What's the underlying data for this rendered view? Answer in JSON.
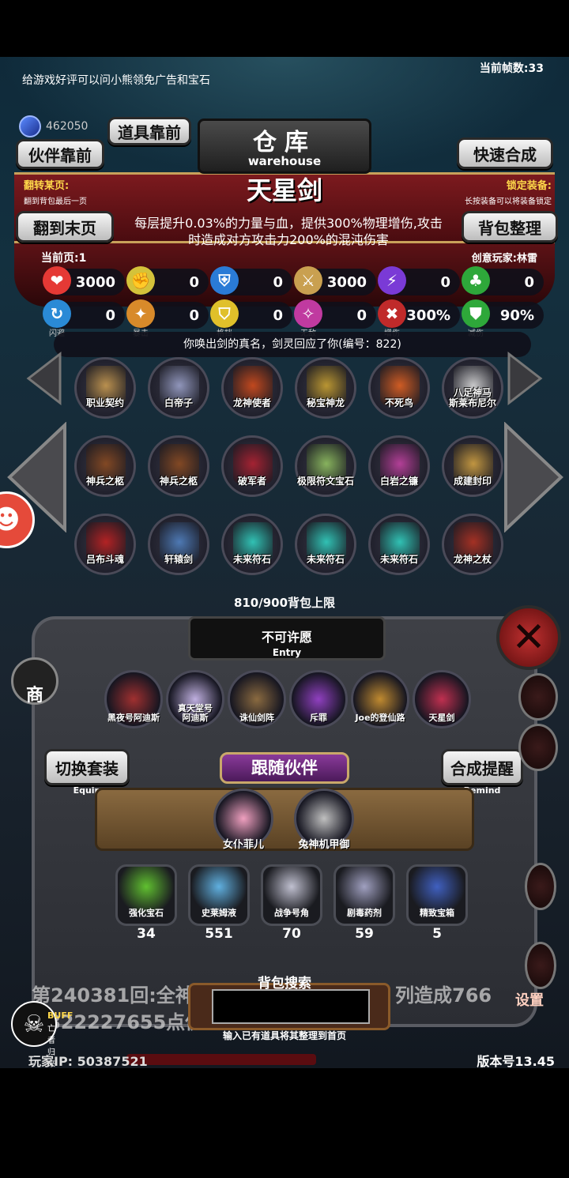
{
  "top_notice": "给游戏好评可以问小熊领免广告和宝石",
  "fps_label": "当前帧数:33",
  "gem_count": "462050",
  "buttons": {
    "props_front": "道具靠前",
    "companion_front": "伙伴靠前",
    "quick_synthesis": "快速合成",
    "jump_last": "翻到末页",
    "bag_sort": "背包整理",
    "switch_set": "切换套装",
    "switch_set_sub": "Equip",
    "synthesis_remind": "合成提醒",
    "synthesis_remind_sub": "Remind"
  },
  "header": {
    "title_cn": "仓库",
    "title_en": "warehouse"
  },
  "flip": {
    "label": "翻转某页:",
    "sub": "翻到背包最后一页"
  },
  "lock": {
    "label": "锁定装备:",
    "sub": "长按装备可以将装备锁定"
  },
  "selected_item": {
    "name": "天星剑",
    "description": "每层提升0.03%的力量与血，提供300%物理增伤,攻击时造成对方攻击力200%的混沌伤害"
  },
  "current_page": "当前页:1",
  "creator": "创意玩家:林雷",
  "stats_row1": [
    {
      "icon": "heart-icon",
      "glyph": "❤",
      "color": "#e53935",
      "value": "3000"
    },
    {
      "icon": "strength-icon",
      "glyph": "✊",
      "color": "#d4c23a",
      "value": "0"
    },
    {
      "icon": "armor-icon",
      "glyph": "⛨",
      "color": "#2a7bd6",
      "value": "0"
    },
    {
      "icon": "sword-icon",
      "glyph": "⚔",
      "color": "#c9a050",
      "value": "3000"
    },
    {
      "icon": "lightning-icon",
      "glyph": "⚡",
      "color": "#7a3ad6",
      "value": "0"
    },
    {
      "icon": "clover-icon",
      "glyph": "♣",
      "color": "#2ea83a",
      "value": "0"
    }
  ],
  "stats_row2": [
    {
      "icon": "dodge-icon",
      "glyph": "↻",
      "color": "#2a8ad6",
      "value": "0",
      "label": "闪避"
    },
    {
      "icon": "crit-icon",
      "glyph": "✦",
      "color": "#d88a2a",
      "value": "0",
      "label": "暴击"
    },
    {
      "icon": "block-icon",
      "glyph": "⛉",
      "color": "#e0c02a",
      "value": "0",
      "label": "格挡"
    },
    {
      "icon": "invincible-icon",
      "glyph": "✧",
      "color": "#c03aa0",
      "value": "0",
      "label": "无敌"
    },
    {
      "icon": "damage-up-icon",
      "glyph": "✖",
      "color": "#c02a2a",
      "value": "300%",
      "label": "增伤"
    },
    {
      "icon": "damage-down-icon",
      "glyph": "⛊",
      "color": "#2ea83a",
      "value": "90%",
      "label": "减伤"
    }
  ],
  "summon_text": "你唤出剑的真名，剑灵回应了你(编号：822)",
  "inventory": [
    {
      "name": "职业契约",
      "color": "#c89a50"
    },
    {
      "name": "白帝子",
      "color": "#9aa0c8"
    },
    {
      "name": "龙神使者",
      "color": "#d04a1a"
    },
    {
      "name": "秘宝神龙",
      "color": "#c8a030"
    },
    {
      "name": "不死鸟",
      "color": "#e06020"
    },
    {
      "name": "八足神马\n斯莱布尼尔",
      "color": "#d8d8d8"
    },
    {
      "name": "神兵之柩",
      "color": "#8a4a20"
    },
    {
      "name": "神兵之柩",
      "color": "#8a4a20"
    },
    {
      "name": "破军者",
      "color": "#b02030"
    },
    {
      "name": "极限符文宝石",
      "color": "#90c060"
    },
    {
      "name": "白岩之镰",
      "color": "#c040a0"
    },
    {
      "name": "成建封印",
      "color": "#d0a040"
    },
    {
      "name": "吕布斗魂",
      "color": "#c02020"
    },
    {
      "name": "轩辕剑",
      "color": "#5080c0"
    },
    {
      "name": "未来符石",
      "color": "#30d0c0"
    },
    {
      "name": "未来符石",
      "color": "#30d0c0"
    },
    {
      "name": "未来符石",
      "color": "#30d0c0"
    },
    {
      "name": "龙神之杖",
      "color": "#b03020"
    }
  ],
  "capacity": "810/900背包上限",
  "entry": {
    "title": "不可许愿",
    "sub": "Entry"
  },
  "equipped": [
    {
      "name": "黑夜号阿迪斯",
      "color": "#a03030"
    },
    {
      "name": "真天堂号\n阿迪斯",
      "color": "#c0b0e0"
    },
    {
      "name": "诛仙剑阵",
      "color": "#8a6a40"
    },
    {
      "name": "斥罪",
      "color": "#9040c0"
    },
    {
      "name": "Joe的登仙路",
      "color": "#c08a30"
    },
    {
      "name": "天星剑",
      "color": "#c03050"
    }
  ],
  "companion_title": "跟随伙伴",
  "companions": [
    {
      "name": "女仆菲儿",
      "color": "#f0a0c0"
    },
    {
      "name": "兔神机甲御",
      "color": "#c0c0c0"
    }
  ],
  "materials": [
    {
      "name": "强化宝石",
      "count": "34",
      "color": "#60c030"
    },
    {
      "name": "史莱姆液",
      "count": "551",
      "color": "#60b0e0"
    },
    {
      "name": "战争号角",
      "count": "70",
      "color": "#c0c0d0"
    },
    {
      "name": "剧毒药剂",
      "count": "59",
      "color": "#a0a0c0"
    },
    {
      "name": "精致宝箱",
      "count": "5",
      "color": "#4060c0"
    }
  ],
  "battle_log_1": "第240381回:全神",
  "battle_log_1b": "列造成766",
  "battle_log_2": "822227655点伤",
  "search": {
    "title": "背包搜索",
    "placeholder": "",
    "hint": "输入已有道具将其整理到首页"
  },
  "buff": {
    "label": "BUFF",
    "sub": "亡者归来"
  },
  "shop_label": "商",
  "settings_label": "设置",
  "player_ip": "玩家IP: 50387521",
  "version": "版本号13.45"
}
